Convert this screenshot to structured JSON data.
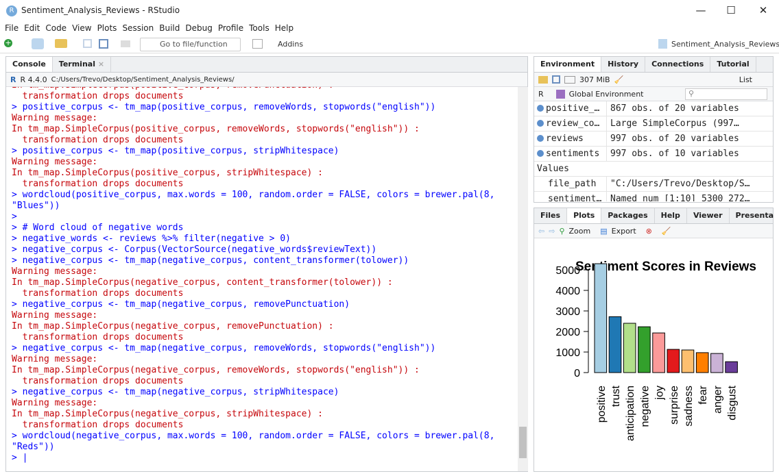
{
  "window": {
    "title": "Sentiment_Analysis_Reviews - RStudio",
    "logo": "R",
    "controls": [
      "—",
      "☐",
      "✕"
    ]
  },
  "menu": [
    "File",
    "Edit",
    "Code",
    "View",
    "Plots",
    "Session",
    "Build",
    "Debug",
    "Profile",
    "Tools",
    "Help"
  ],
  "toolbar": {
    "goto_placeholder": "Go to file/function",
    "addins": "Addins",
    "project": "Sentiment_Analysis_Reviews"
  },
  "console": {
    "tabs": [
      "Console",
      "Terminal"
    ],
    "version": "R 4.4.0",
    "path": "C:/Users/Trevo/Desktop/Sentiment_Analysis_Reviews/",
    "lines": [
      {
        "t": "err",
        "s": "In tm_map.SimpleCorpus(positive_corpus, removePunctuation) :"
      },
      {
        "t": "err",
        "s": "  transformation drops documents"
      },
      {
        "t": "cmd",
        "s": "> positive_corpus <- tm_map(positive_corpus, removeWords, stopwords(\"english\"))"
      },
      {
        "t": "err",
        "s": "Warning message:"
      },
      {
        "t": "err",
        "s": "In tm_map.SimpleCorpus(positive_corpus, removeWords, stopwords(\"english\")) :"
      },
      {
        "t": "err",
        "s": "  transformation drops documents"
      },
      {
        "t": "cmd",
        "s": "> positive_corpus <- tm_map(positive_corpus, stripWhitespace)"
      },
      {
        "t": "err",
        "s": "Warning message:"
      },
      {
        "t": "err",
        "s": "In tm_map.SimpleCorpus(positive_corpus, stripWhitespace) :"
      },
      {
        "t": "err",
        "s": "  transformation drops documents"
      },
      {
        "t": "cmd",
        "s": "> wordcloud(positive_corpus, max.words = 100, random.order = FALSE, colors = brewer.pal(8,"
      },
      {
        "t": "cmd",
        "s": "\"Blues\"))"
      },
      {
        "t": "cmd",
        "s": ">"
      },
      {
        "t": "cmd",
        "s": "> # Word cloud of negative words"
      },
      {
        "t": "cmd",
        "s": "> negative_words <- reviews %>% filter(negative > 0)"
      },
      {
        "t": "cmd",
        "s": "> negative_corpus <- Corpus(VectorSource(negative_words$reviewText))"
      },
      {
        "t": "cmd",
        "s": "> negative_corpus <- tm_map(negative_corpus, content_transformer(tolower))"
      },
      {
        "t": "err",
        "s": "Warning message:"
      },
      {
        "t": "err",
        "s": "In tm_map.SimpleCorpus(negative_corpus, content_transformer(tolower)) :"
      },
      {
        "t": "err",
        "s": "  transformation drops documents"
      },
      {
        "t": "cmd",
        "s": "> negative_corpus <- tm_map(negative_corpus, removePunctuation)"
      },
      {
        "t": "err",
        "s": "Warning message:"
      },
      {
        "t": "err",
        "s": "In tm_map.SimpleCorpus(negative_corpus, removePunctuation) :"
      },
      {
        "t": "err",
        "s": "  transformation drops documents"
      },
      {
        "t": "cmd",
        "s": "> negative_corpus <- tm_map(negative_corpus, removeWords, stopwords(\"english\"))"
      },
      {
        "t": "err",
        "s": "Warning message:"
      },
      {
        "t": "err",
        "s": "In tm_map.SimpleCorpus(negative_corpus, removeWords, stopwords(\"english\")) :"
      },
      {
        "t": "err",
        "s": "  transformation drops documents"
      },
      {
        "t": "cmd",
        "s": "> negative_corpus <- tm_map(negative_corpus, stripWhitespace)"
      },
      {
        "t": "err",
        "s": "Warning message:"
      },
      {
        "t": "err",
        "s": "In tm_map.SimpleCorpus(negative_corpus, stripWhitespace) :"
      },
      {
        "t": "err",
        "s": "  transformation drops documents"
      },
      {
        "t": "cmd",
        "s": "> wordcloud(negative_corpus, max.words = 100, random.order = FALSE, colors = brewer.pal(8,"
      },
      {
        "t": "cmd",
        "s": "\"Reds\"))"
      },
      {
        "t": "cmd",
        "s": "> |"
      }
    ]
  },
  "environment": {
    "tabs": [
      "Environment",
      "History",
      "Connections",
      "Tutorial"
    ],
    "memory": "307 MiB",
    "view": "List",
    "lang": "R",
    "scope": "Global Environment",
    "data": [
      {
        "name": "positive_…",
        "value": "867 obs. of 20 variables"
      },
      {
        "name": "review_co…",
        "value": "Large SimpleCorpus (997…"
      },
      {
        "name": "reviews",
        "value": "997 obs. of 20 variables"
      },
      {
        "name": "sentiments",
        "value": "997 obs. of 10 variables"
      }
    ],
    "values_header": "Values",
    "values": [
      {
        "name": "file_path",
        "value": "\"C:/Users/Trevo/Desktop/S…"
      },
      {
        "name": "sentiment…",
        "value": "Named num [1:10] 5300 272…"
      }
    ]
  },
  "plots": {
    "tabs": [
      "Files",
      "Plots",
      "Packages",
      "Help",
      "Viewer",
      "Presenta"
    ],
    "zoom": "Zoom",
    "export": "Export"
  },
  "chart_data": {
    "type": "bar",
    "title": "Sentiment Scores in Reviews",
    "categories": [
      "positive",
      "trust",
      "anticipation",
      "negative",
      "joy",
      "surprise",
      "sadness",
      "fear",
      "anger",
      "disgust"
    ],
    "values": [
      5300,
      2720,
      2400,
      2230,
      1930,
      1130,
      1100,
      970,
      930,
      530
    ],
    "colors": [
      "#A6CEE3",
      "#1F78B4",
      "#B2DF8A",
      "#33A02C",
      "#FB9A99",
      "#E31A1C",
      "#FDBF6F",
      "#FF7F00",
      "#CAB2D6",
      "#6A3D9A"
    ],
    "yticks": [
      "0",
      "1000",
      "2000",
      "3000",
      "4000",
      "5000"
    ],
    "ylim": [
      0,
      5000
    ],
    "grid": false
  }
}
